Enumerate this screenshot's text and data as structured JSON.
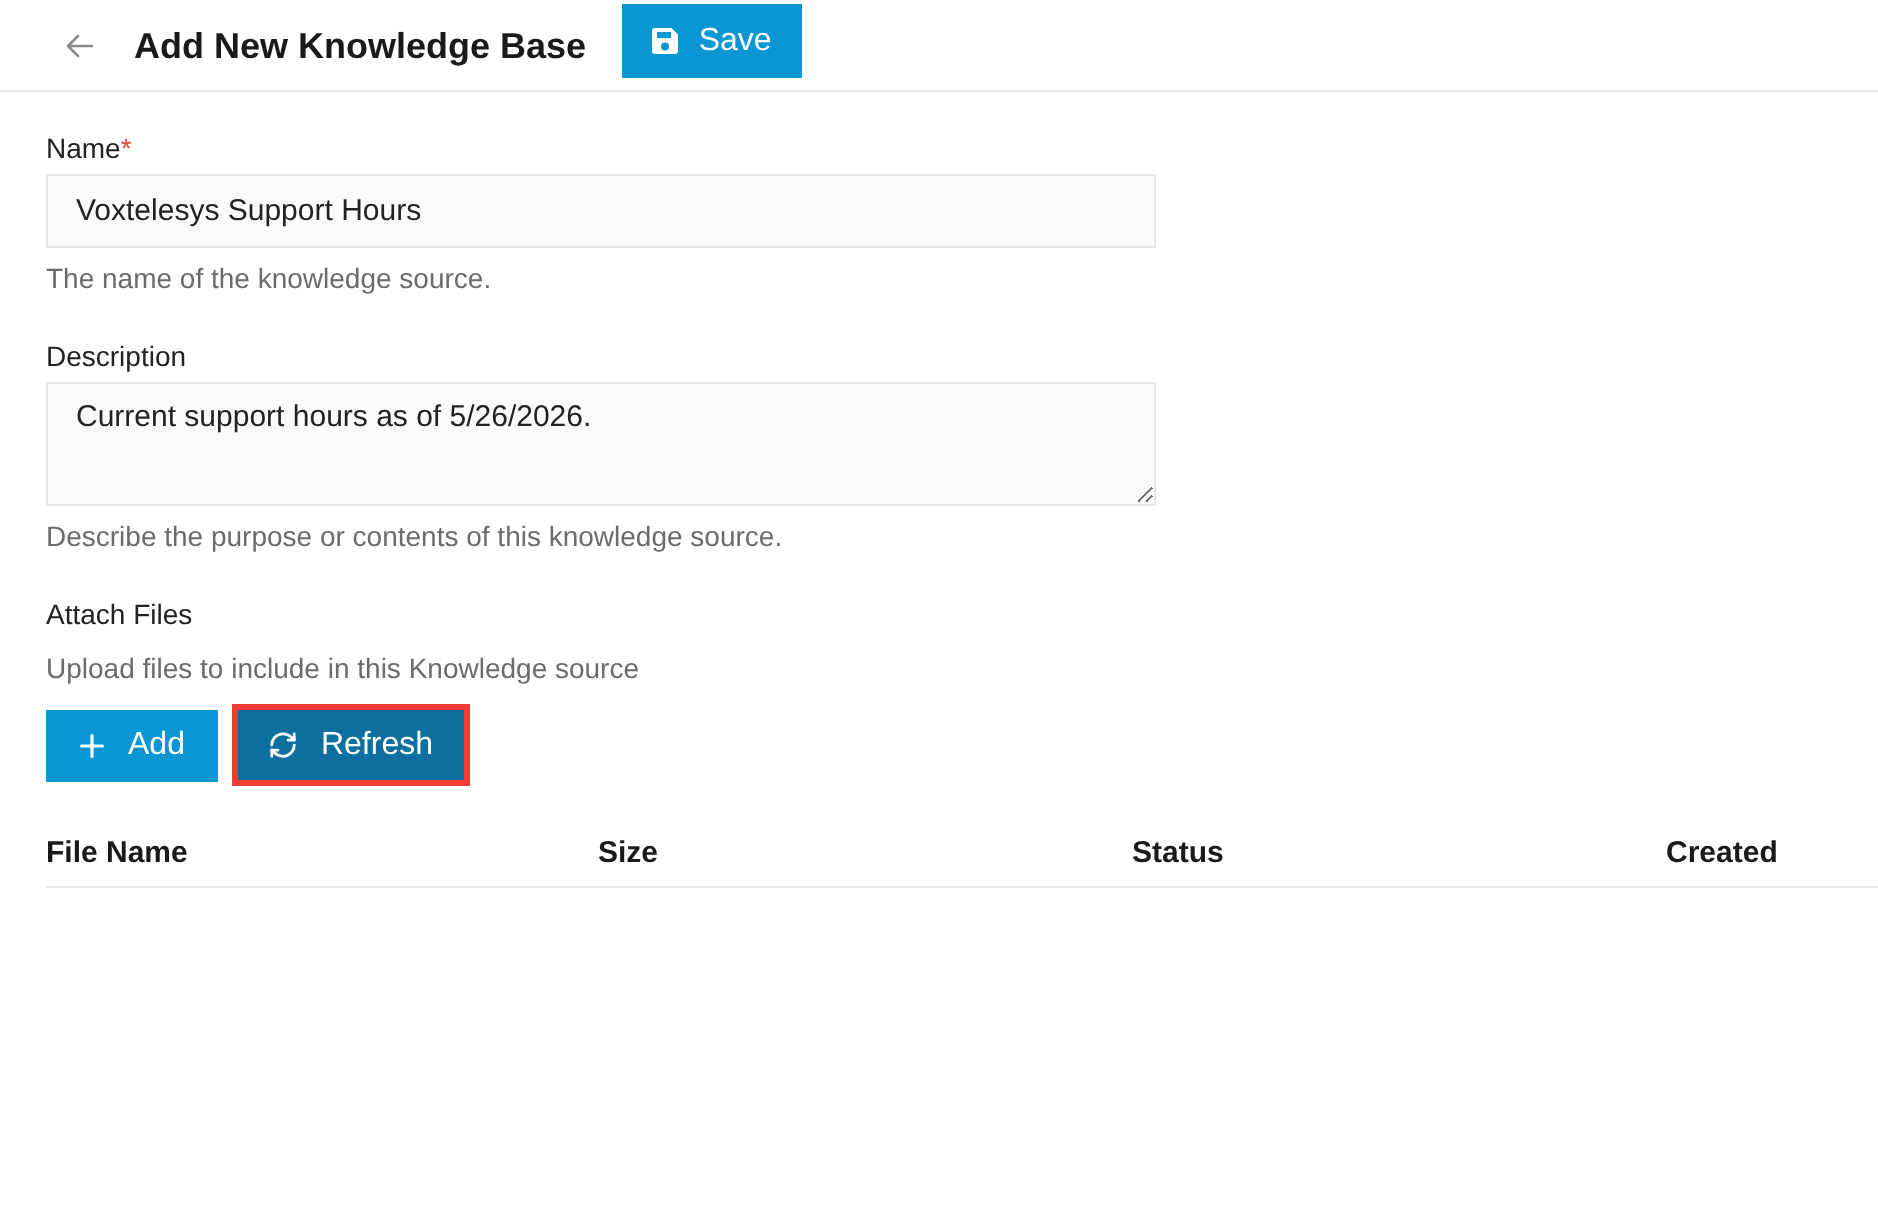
{
  "header": {
    "title": "Add New Knowledge Base",
    "save_button": "Save"
  },
  "fields": [
    {
      "kind": "input",
      "label": "Name",
      "required_mark": "*",
      "value": "Voxtelesys Support Hours",
      "help": "The name of the knowledge source."
    },
    {
      "kind": "textarea",
      "label": "Description",
      "value": "Current support hours as of 5/26/2026.",
      "help": "Describe the purpose or contents of this knowledge source."
    }
  ],
  "attach": {
    "title": "Attach Files",
    "subtitle": "Upload files to include in this Knowledge source",
    "buttons": [
      {
        "kind": "add",
        "label": "Add",
        "highlighted": false
      },
      {
        "kind": "refresh",
        "label": "Refresh",
        "highlighted": true
      }
    ]
  },
  "table": {
    "columns": [
      "File Name",
      "Size",
      "Status",
      "Created"
    ]
  }
}
